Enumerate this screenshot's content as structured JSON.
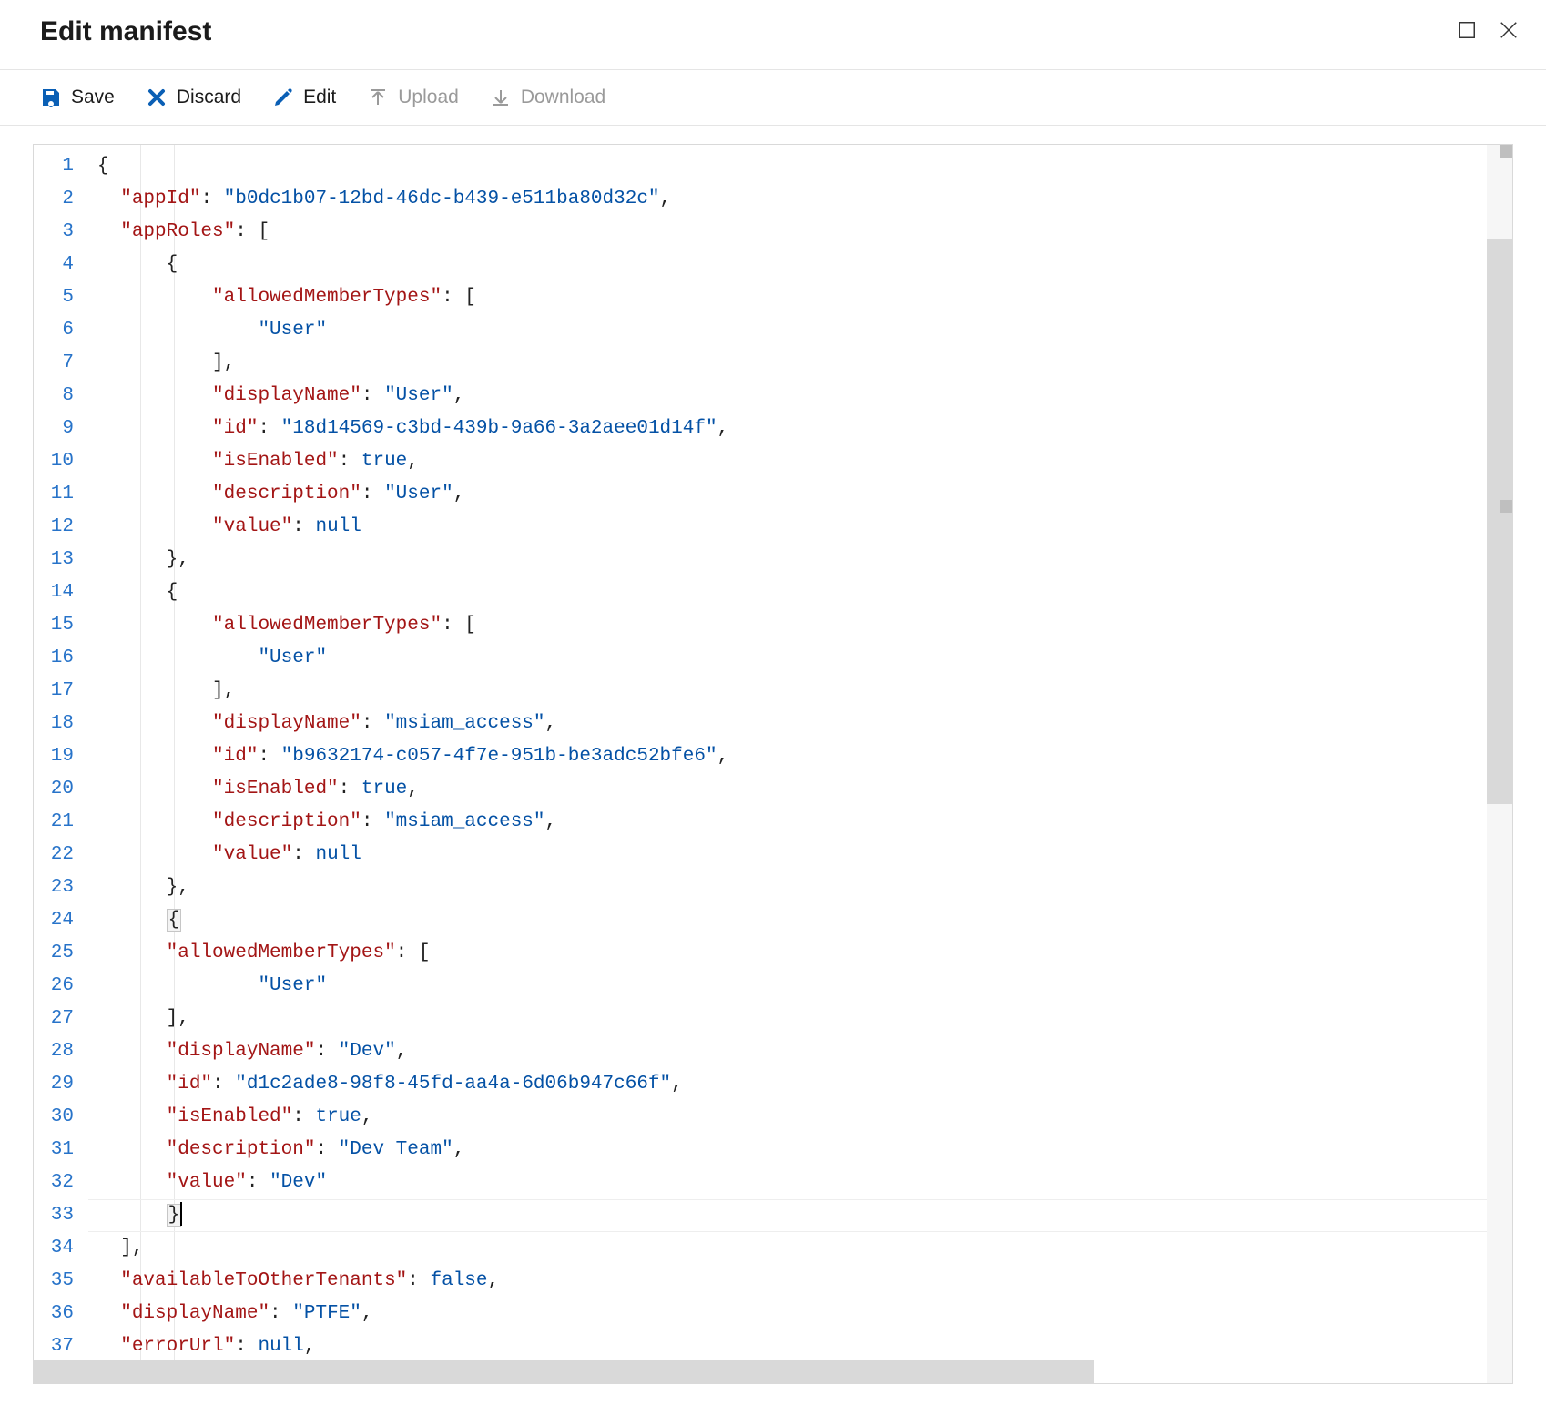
{
  "title": "Edit manifest",
  "toolbar": {
    "save": "Save",
    "discard": "Discard",
    "edit": "Edit",
    "upload": "Upload",
    "download": "Download"
  },
  "editor": {
    "line_count": 37,
    "tokens": [
      [
        [
          "punc",
          "{"
        ]
      ],
      [
        [
          "indent",
          "  "
        ],
        [
          "key",
          "\"appId\""
        ],
        [
          "punc",
          ": "
        ],
        [
          "str",
          "\"b0dc1b07-12bd-46dc-b439-e511ba80d32c\""
        ],
        [
          "punc",
          ","
        ]
      ],
      [
        [
          "indent",
          "  "
        ],
        [
          "key",
          "\"appRoles\""
        ],
        [
          "punc",
          ": ["
        ]
      ],
      [
        [
          "indent",
          "      "
        ],
        [
          "punc",
          "{"
        ]
      ],
      [
        [
          "indent",
          "          "
        ],
        [
          "key",
          "\"allowedMemberTypes\""
        ],
        [
          "punc",
          ": ["
        ]
      ],
      [
        [
          "indent",
          "              "
        ],
        [
          "str",
          "\"User\""
        ]
      ],
      [
        [
          "indent",
          "          "
        ],
        [
          "punc",
          "],"
        ]
      ],
      [
        [
          "indent",
          "          "
        ],
        [
          "key",
          "\"displayName\""
        ],
        [
          "punc",
          ": "
        ],
        [
          "str",
          "\"User\""
        ],
        [
          "punc",
          ","
        ]
      ],
      [
        [
          "indent",
          "          "
        ],
        [
          "key",
          "\"id\""
        ],
        [
          "punc",
          ": "
        ],
        [
          "str",
          "\"18d14569-c3bd-439b-9a66-3a2aee01d14f\""
        ],
        [
          "punc",
          ","
        ]
      ],
      [
        [
          "indent",
          "          "
        ],
        [
          "key",
          "\"isEnabled\""
        ],
        [
          "punc",
          ": "
        ],
        [
          "kw",
          "true"
        ],
        [
          "punc",
          ","
        ]
      ],
      [
        [
          "indent",
          "          "
        ],
        [
          "key",
          "\"description\""
        ],
        [
          "punc",
          ": "
        ],
        [
          "str",
          "\"User\""
        ],
        [
          "punc",
          ","
        ]
      ],
      [
        [
          "indent",
          "          "
        ],
        [
          "key",
          "\"value\""
        ],
        [
          "punc",
          ": "
        ],
        [
          "kw",
          "null"
        ]
      ],
      [
        [
          "indent",
          "      "
        ],
        [
          "punc",
          "},"
        ]
      ],
      [
        [
          "indent",
          "      "
        ],
        [
          "punc",
          "{"
        ]
      ],
      [
        [
          "indent",
          "          "
        ],
        [
          "key",
          "\"allowedMemberTypes\""
        ],
        [
          "punc",
          ": ["
        ]
      ],
      [
        [
          "indent",
          "              "
        ],
        [
          "str",
          "\"User\""
        ]
      ],
      [
        [
          "indent",
          "          "
        ],
        [
          "punc",
          "],"
        ]
      ],
      [
        [
          "indent",
          "          "
        ],
        [
          "key",
          "\"displayName\""
        ],
        [
          "punc",
          ": "
        ],
        [
          "str",
          "\"msiam_access\""
        ],
        [
          "punc",
          ","
        ]
      ],
      [
        [
          "indent",
          "          "
        ],
        [
          "key",
          "\"id\""
        ],
        [
          "punc",
          ": "
        ],
        [
          "str",
          "\"b9632174-c057-4f7e-951b-be3adc52bfe6\""
        ],
        [
          "punc",
          ","
        ]
      ],
      [
        [
          "indent",
          "          "
        ],
        [
          "key",
          "\"isEnabled\""
        ],
        [
          "punc",
          ": "
        ],
        [
          "kw",
          "true"
        ],
        [
          "punc",
          ","
        ]
      ],
      [
        [
          "indent",
          "          "
        ],
        [
          "key",
          "\"description\""
        ],
        [
          "punc",
          ": "
        ],
        [
          "str",
          "\"msiam_access\""
        ],
        [
          "punc",
          ","
        ]
      ],
      [
        [
          "indent",
          "          "
        ],
        [
          "key",
          "\"value\""
        ],
        [
          "punc",
          ": "
        ],
        [
          "kw",
          "null"
        ]
      ],
      [
        [
          "indent",
          "      "
        ],
        [
          "punc",
          "},"
        ]
      ],
      [
        [
          "indent",
          "      "
        ],
        [
          "selbox",
          "{"
        ]
      ],
      [
        [
          "indent",
          "      "
        ],
        [
          "key",
          "\"allowedMemberTypes\""
        ],
        [
          "punc",
          ": ["
        ]
      ],
      [
        [
          "indent",
          "              "
        ],
        [
          "str",
          "\"User\""
        ]
      ],
      [
        [
          "indent",
          "      "
        ],
        [
          "punc",
          "],"
        ]
      ],
      [
        [
          "indent",
          "      "
        ],
        [
          "key",
          "\"displayName\""
        ],
        [
          "punc",
          ": "
        ],
        [
          "str",
          "\"Dev\""
        ],
        [
          "punc",
          ","
        ]
      ],
      [
        [
          "indent",
          "      "
        ],
        [
          "key",
          "\"id\""
        ],
        [
          "punc",
          ": "
        ],
        [
          "str",
          "\"d1c2ade8-98f8-45fd-aa4a-6d06b947c66f\""
        ],
        [
          "punc",
          ","
        ]
      ],
      [
        [
          "indent",
          "      "
        ],
        [
          "key",
          "\"isEnabled\""
        ],
        [
          "punc",
          ": "
        ],
        [
          "kw",
          "true"
        ],
        [
          "punc",
          ","
        ]
      ],
      [
        [
          "indent",
          "      "
        ],
        [
          "key",
          "\"description\""
        ],
        [
          "punc",
          ": "
        ],
        [
          "str",
          "\"Dev Team\""
        ],
        [
          "punc",
          ","
        ]
      ],
      [
        [
          "indent",
          "      "
        ],
        [
          "key",
          "\"value\""
        ],
        [
          "punc",
          ": "
        ],
        [
          "str",
          "\"Dev\""
        ]
      ],
      [
        [
          "indent",
          "      "
        ],
        [
          "selbox",
          "}"
        ],
        [
          "cursor",
          ""
        ]
      ],
      [
        [
          "indent",
          "  "
        ],
        [
          "punc",
          "],"
        ]
      ],
      [
        [
          "indent",
          "  "
        ],
        [
          "key",
          "\"availableToOtherTenants\""
        ],
        [
          "punc",
          ": "
        ],
        [
          "kw",
          "false"
        ],
        [
          "punc",
          ","
        ]
      ],
      [
        [
          "indent",
          "  "
        ],
        [
          "key",
          "\"displayName\""
        ],
        [
          "punc",
          ": "
        ],
        [
          "str",
          "\"PTFE\""
        ],
        [
          "punc",
          ","
        ]
      ],
      [
        [
          "indent",
          "  "
        ],
        [
          "key",
          "\"errorUrl\""
        ],
        [
          "punc",
          ": "
        ],
        [
          "kw",
          "null"
        ],
        [
          "punc",
          ","
        ]
      ]
    ],
    "highlight_line": 33,
    "selection_line": 24
  }
}
